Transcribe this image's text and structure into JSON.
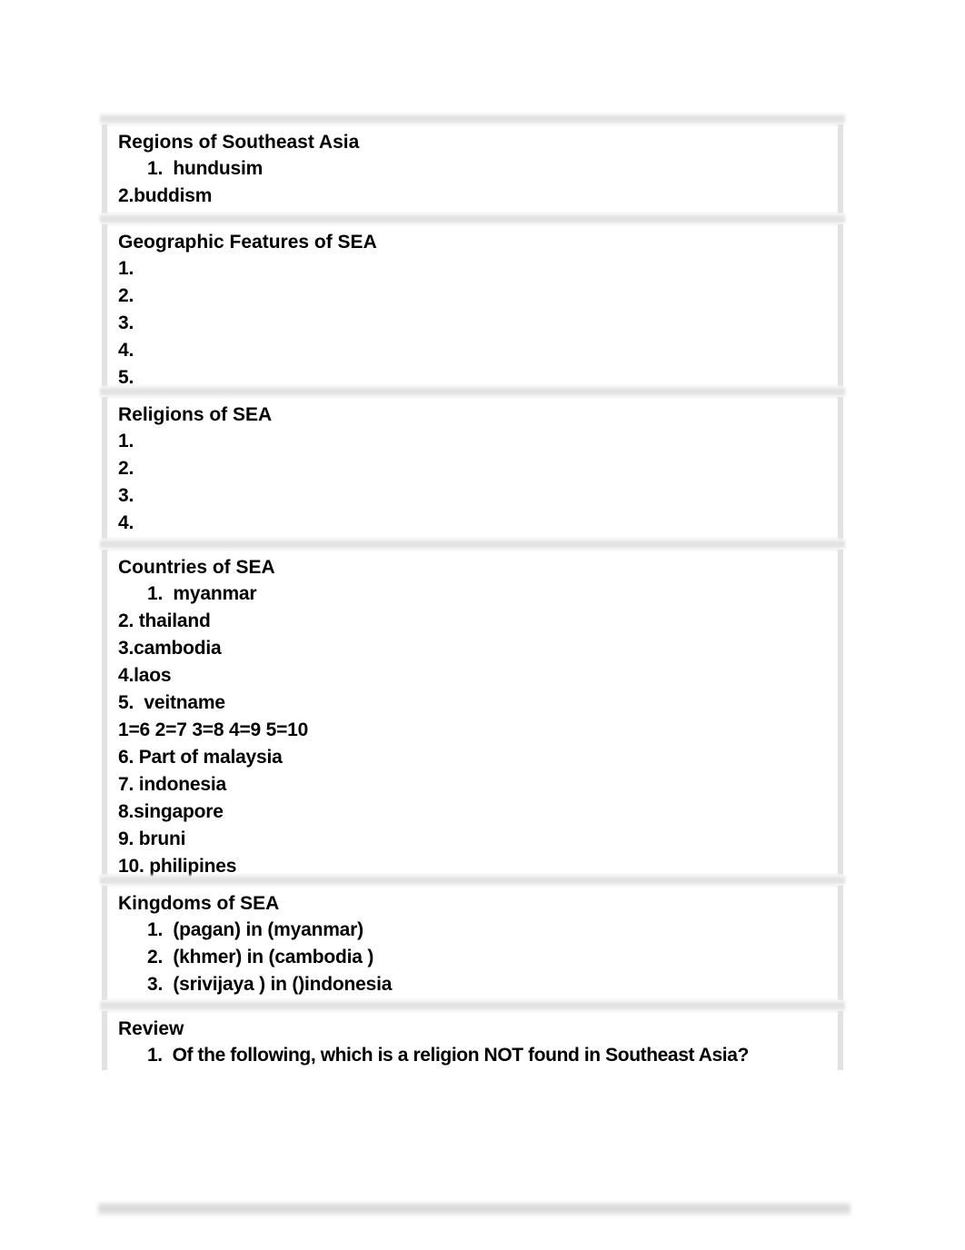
{
  "sections": [
    {
      "heading": "Regions of Southeast Asia",
      "lines": [
        {
          "text": "1.  hundusim",
          "indent": true
        },
        {
          "text": "2.buddism",
          "indent": false
        }
      ]
    },
    {
      "heading": "Geographic Features of SEA",
      "lines": [
        {
          "text": "1.",
          "indent": false
        },
        {
          "text": "2.",
          "indent": false
        },
        {
          "text": "3.",
          "indent": false
        },
        {
          "text": "4.",
          "indent": false
        },
        {
          "text": "5.",
          "indent": false
        }
      ]
    },
    {
      "heading": "Religions of SEA",
      "lines": [
        {
          "text": "1.",
          "indent": false
        },
        {
          "text": "2.",
          "indent": false
        },
        {
          "text": "3.",
          "indent": false
        },
        {
          "text": "4.",
          "indent": false
        }
      ]
    },
    {
      "heading": "Countries of SEA",
      "lines": [
        {
          "text": "1.  myanmar",
          "indent": true
        },
        {
          "text": "2. thailand",
          "indent": false
        },
        {
          "text": "3.cambodia",
          "indent": false
        },
        {
          "text": "4.laos",
          "indent": false
        },
        {
          "text": "5.  veitname",
          "indent": false
        },
        {
          "text": "1=6 2=7 3=8 4=9 5=10",
          "indent": false
        },
        {
          "text": "6. Part of malaysia",
          "indent": false
        },
        {
          "text": "7. indonesia",
          "indent": false
        },
        {
          "text": "8.singapore",
          "indent": false
        },
        {
          "text": "9. bruni",
          "indent": false
        },
        {
          "text": "10. philipines",
          "indent": false
        }
      ]
    },
    {
      "heading": "Kingdoms of SEA",
      "lines": [
        {
          "text": "1.  (pagan) in (myanmar)",
          "indent": true
        },
        {
          "text": "2.  (khmer) in (cambodia )",
          "indent": true
        },
        {
          "text": "3.  (srivijaya ) in ()indonesia",
          "indent": true
        }
      ]
    },
    {
      "heading": "Review",
      "lines": [
        {
          "text": "1.  Of the following, which is a religion NOT found in Southeast Asia?",
          "indent": true
        }
      ]
    }
  ]
}
